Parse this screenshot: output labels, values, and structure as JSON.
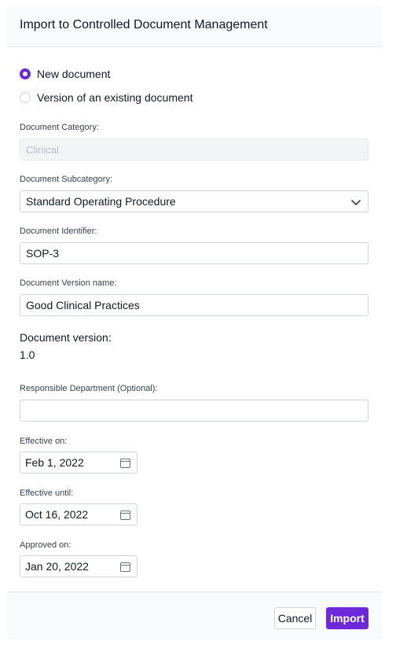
{
  "dialog": {
    "title": "Import to Controlled Document Management"
  },
  "import_type": {
    "options": [
      {
        "label": "New document",
        "selected": true
      },
      {
        "label": "Version of an existing document",
        "selected": false
      }
    ]
  },
  "fields": {
    "category": {
      "label": "Document Category:",
      "value": "Clinical",
      "disabled": true
    },
    "subcategory": {
      "label": "Document Subcategory:",
      "value": "Standard Operating Procedure"
    },
    "identifier": {
      "label": "Document Identifier:",
      "value": "SOP-3"
    },
    "version_name": {
      "label": "Document Version name:",
      "value": "Good Clinical Practices"
    },
    "version": {
      "label": "Document version:",
      "value": "1.0"
    },
    "department": {
      "label": "Responsible Department (Optional):",
      "value": ""
    },
    "effective_on": {
      "label": "Effective on:",
      "value": "Feb 1, 2022"
    },
    "effective_until": {
      "label": "Effective until:",
      "value": "Oct 16, 2022"
    },
    "approved_on": {
      "label": "Approved on:",
      "value": "Jan 20, 2022"
    }
  },
  "footer": {
    "cancel_label": "Cancel",
    "import_label": "Import"
  },
  "colors": {
    "accent": "#6d28d9",
    "header_bg": "#f9fafb",
    "border": "#d1d5db"
  },
  "icons": {
    "dropdown": "chevron-down-icon",
    "date": "calendar-icon"
  }
}
